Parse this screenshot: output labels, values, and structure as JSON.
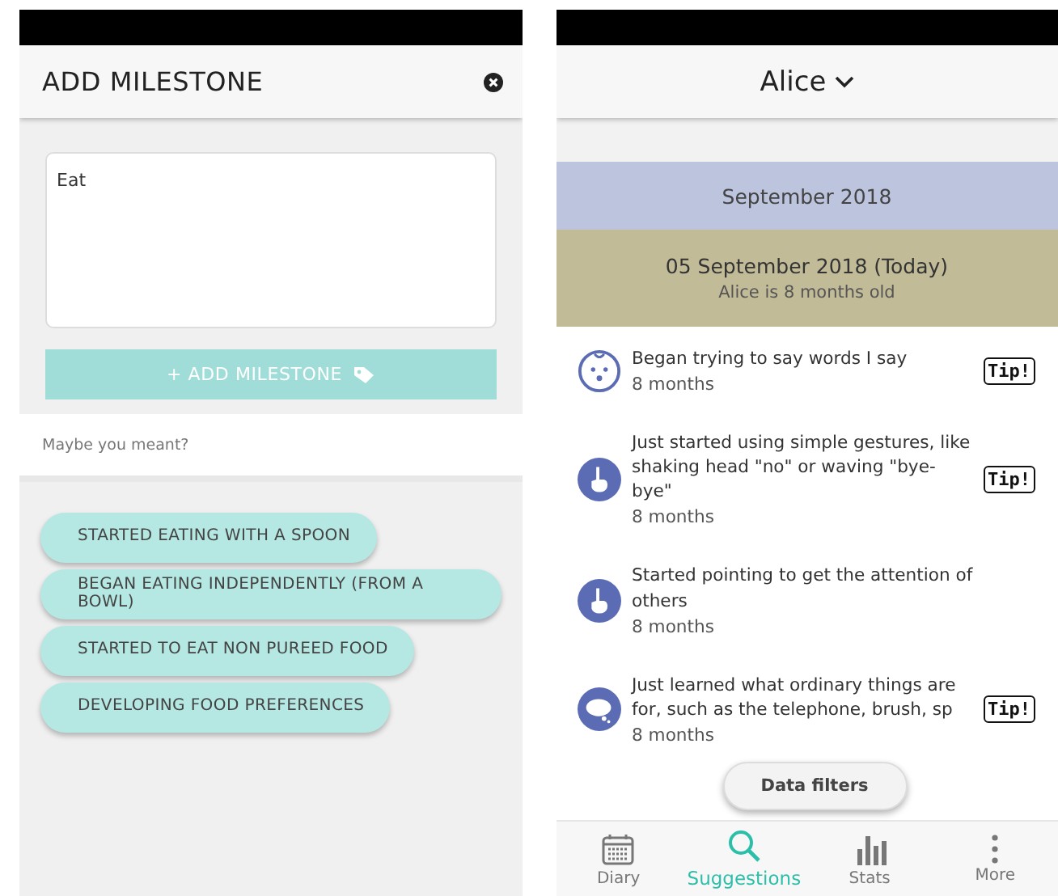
{
  "add_milestone": {
    "title": "ADD MILESTONE",
    "field": {
      "value": "Eat"
    },
    "add_button": "+ ADD MILESTONE",
    "hint": "Maybe you meant?",
    "suggestions": [
      {
        "label": "STARTED EATING WITH A SPOON"
      },
      {
        "label": "BEGAN EATING INDEPENDENTLY (FROM A BOWL)"
      },
      {
        "label": "STARTED TO EAT NON PUREED FOOD"
      },
      {
        "label": "DEVELOPING FOOD PREFERENCES"
      }
    ]
  },
  "suggestions_screen": {
    "child": "Alice",
    "month_header": "September 2018",
    "day_header": {
      "date": "05 September 2018 (Today)",
      "subtitle": "Alice is 8 months old"
    },
    "items": [
      {
        "kind": "face",
        "text": "Began trying to say words I say",
        "age": "8 months",
        "tip": "Tip!"
      },
      {
        "kind": "hand",
        "text": "Just started using simple gestures, like shaking head \"no\" or waving \"bye-bye\"",
        "age": "8 months",
        "tip": "Tip!"
      },
      {
        "kind": "hand",
        "text": "Started pointing to get the attention of others",
        "age": "8 months"
      },
      {
        "kind": "speech",
        "text": "Just learned what ordinary things are for, such as the telephone, brush, sp",
        "age": "8 months",
        "tip": "Tip!"
      }
    ],
    "filter_button": "Data filters",
    "tabs": [
      {
        "kind": "calendar",
        "label": "Diary",
        "selected": false
      },
      {
        "kind": "search",
        "label": "Suggestions",
        "selected": true
      },
      {
        "kind": "stats",
        "label": "Stats",
        "selected": false
      },
      {
        "kind": "more",
        "label": "More",
        "selected": false
      }
    ]
  }
}
